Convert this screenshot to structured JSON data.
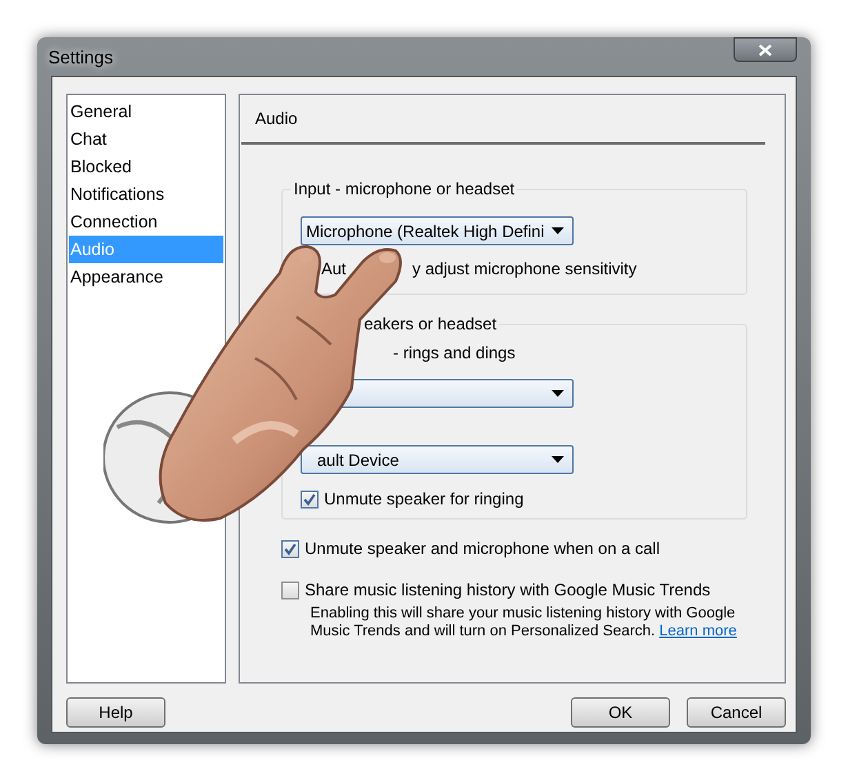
{
  "window": {
    "title": "Settings"
  },
  "sidebar": {
    "items": [
      {
        "label": "General",
        "selected": false
      },
      {
        "label": "Chat",
        "selected": false
      },
      {
        "label": "Blocked",
        "selected": false
      },
      {
        "label": "Notifications",
        "selected": false
      },
      {
        "label": "Connection",
        "selected": false
      },
      {
        "label": "Audio",
        "selected": true
      },
      {
        "label": "Appearance",
        "selected": false
      }
    ]
  },
  "panel": {
    "title": "Audio",
    "input_group": {
      "title": "Input - microphone or headset",
      "dropdown": {
        "value": "Microphone (Realtek High Defini"
      },
      "checkbox_label_parts": [
        "Aut",
        "y adjust microphone sensitivity"
      ]
    },
    "output_group": {
      "title": "eakers or headset",
      "ring_label": "- rings and dings",
      "device_dropdown": {
        "value": "ault Device"
      },
      "checkbox": {
        "label": "Unmute speaker for ringing",
        "checked": true
      }
    },
    "options": [
      {
        "label": "Unmute speaker and microphone when on a call",
        "checked": true
      },
      {
        "label": "Share music listening history with Google Music Trends",
        "checked": false,
        "description": "Enabling this will share your music listening history with Google Music Trends and will turn on Personalized Search.",
        "link": "Learn more"
      }
    ]
  },
  "help_button": "Help",
  "action_buttons": [
    "OK",
    "Cancel"
  ]
}
